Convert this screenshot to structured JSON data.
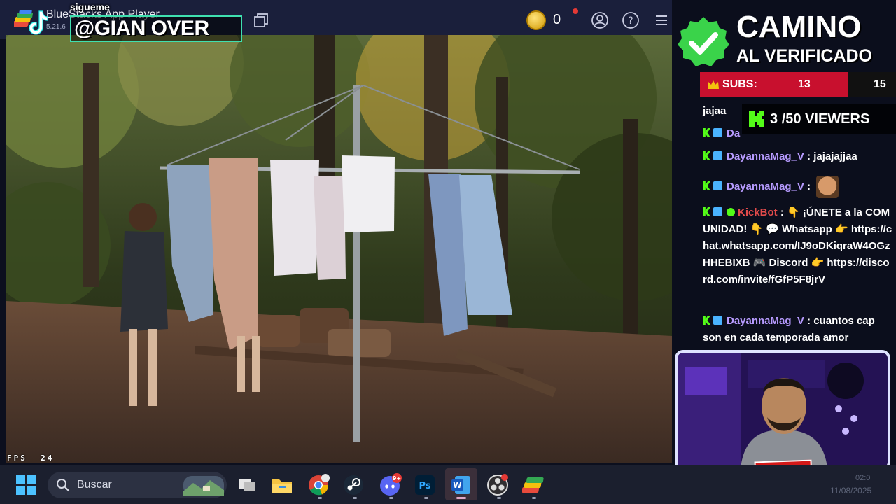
{
  "window": {
    "app_title": "BlueStacks App Player",
    "version": "5.21.6"
  },
  "coins": {
    "count": "0"
  },
  "overlay": {
    "follow_label": "sigueme",
    "handle": "@GIAN OVER"
  },
  "fps": {
    "label": "FPS",
    "value": "24"
  },
  "campaign": {
    "title_line1": "CAMINO",
    "title_line2": "AL VERIFICADO"
  },
  "subs": {
    "label": "SUBS:",
    "current": "13",
    "goal": "15",
    "progress": 0.8667
  },
  "viewers": {
    "current": "3",
    "separator": "/",
    "goal_text": "50 VIEWERS"
  },
  "chat": {
    "messages": [
      {
        "user": "",
        "text": "jajaa"
      },
      {
        "user": "Da",
        "text": ""
      },
      {
        "user": "DayannaMag_V",
        "sep": ":",
        "text": "jajajajjaa"
      },
      {
        "user": "DayannaMag_V",
        "sep": ":",
        "text": ""
      },
      {
        "user": "KickBot",
        "sep": ":",
        "text": "👇 ¡ÚNETE a la COMUNIDAD! 👇 💬 Whatsapp 👉 https://chat.whatsapp.com/IJ9oDKiqraW4OGzHHEBIXB 🎮 Discord 👉 https://discord.com/invite/fGfP5F8jrV"
      },
      {
        "user": "DayannaMag_V",
        "sep": ":",
        "text": "cuantos cap son en cada temporada amor"
      }
    ]
  },
  "webcam": {
    "streamer_tag": "GIAN OVER"
  },
  "taskbar": {
    "search_placeholder": "Buscar",
    "discord_badge": "9+",
    "word_label": "W",
    "ps_label": "Ps",
    "time": "02:0",
    "date": "11/08/2025"
  },
  "colors": {
    "accent_green": "#53fc18",
    "subs_red": "#c8102e",
    "chat_user": "#b79bff",
    "bot_red": "#e24b4b",
    "titlebar": "#1a1f3b"
  },
  "icons": [
    "bluestacks-logo",
    "tiktok-logo",
    "multi-instance-icon",
    "coin-icon",
    "account-icon",
    "help-icon",
    "menu-icon",
    "verified-check-icon",
    "crown-icon",
    "kick-logo",
    "windows-start-icon",
    "search-icon",
    "task-view-icon",
    "file-explorer-icon",
    "chrome-icon",
    "steam-icon",
    "discord-icon",
    "photoshop-icon",
    "word-icon",
    "obs-icon",
    "bluestacks-taskbar-icon"
  ]
}
